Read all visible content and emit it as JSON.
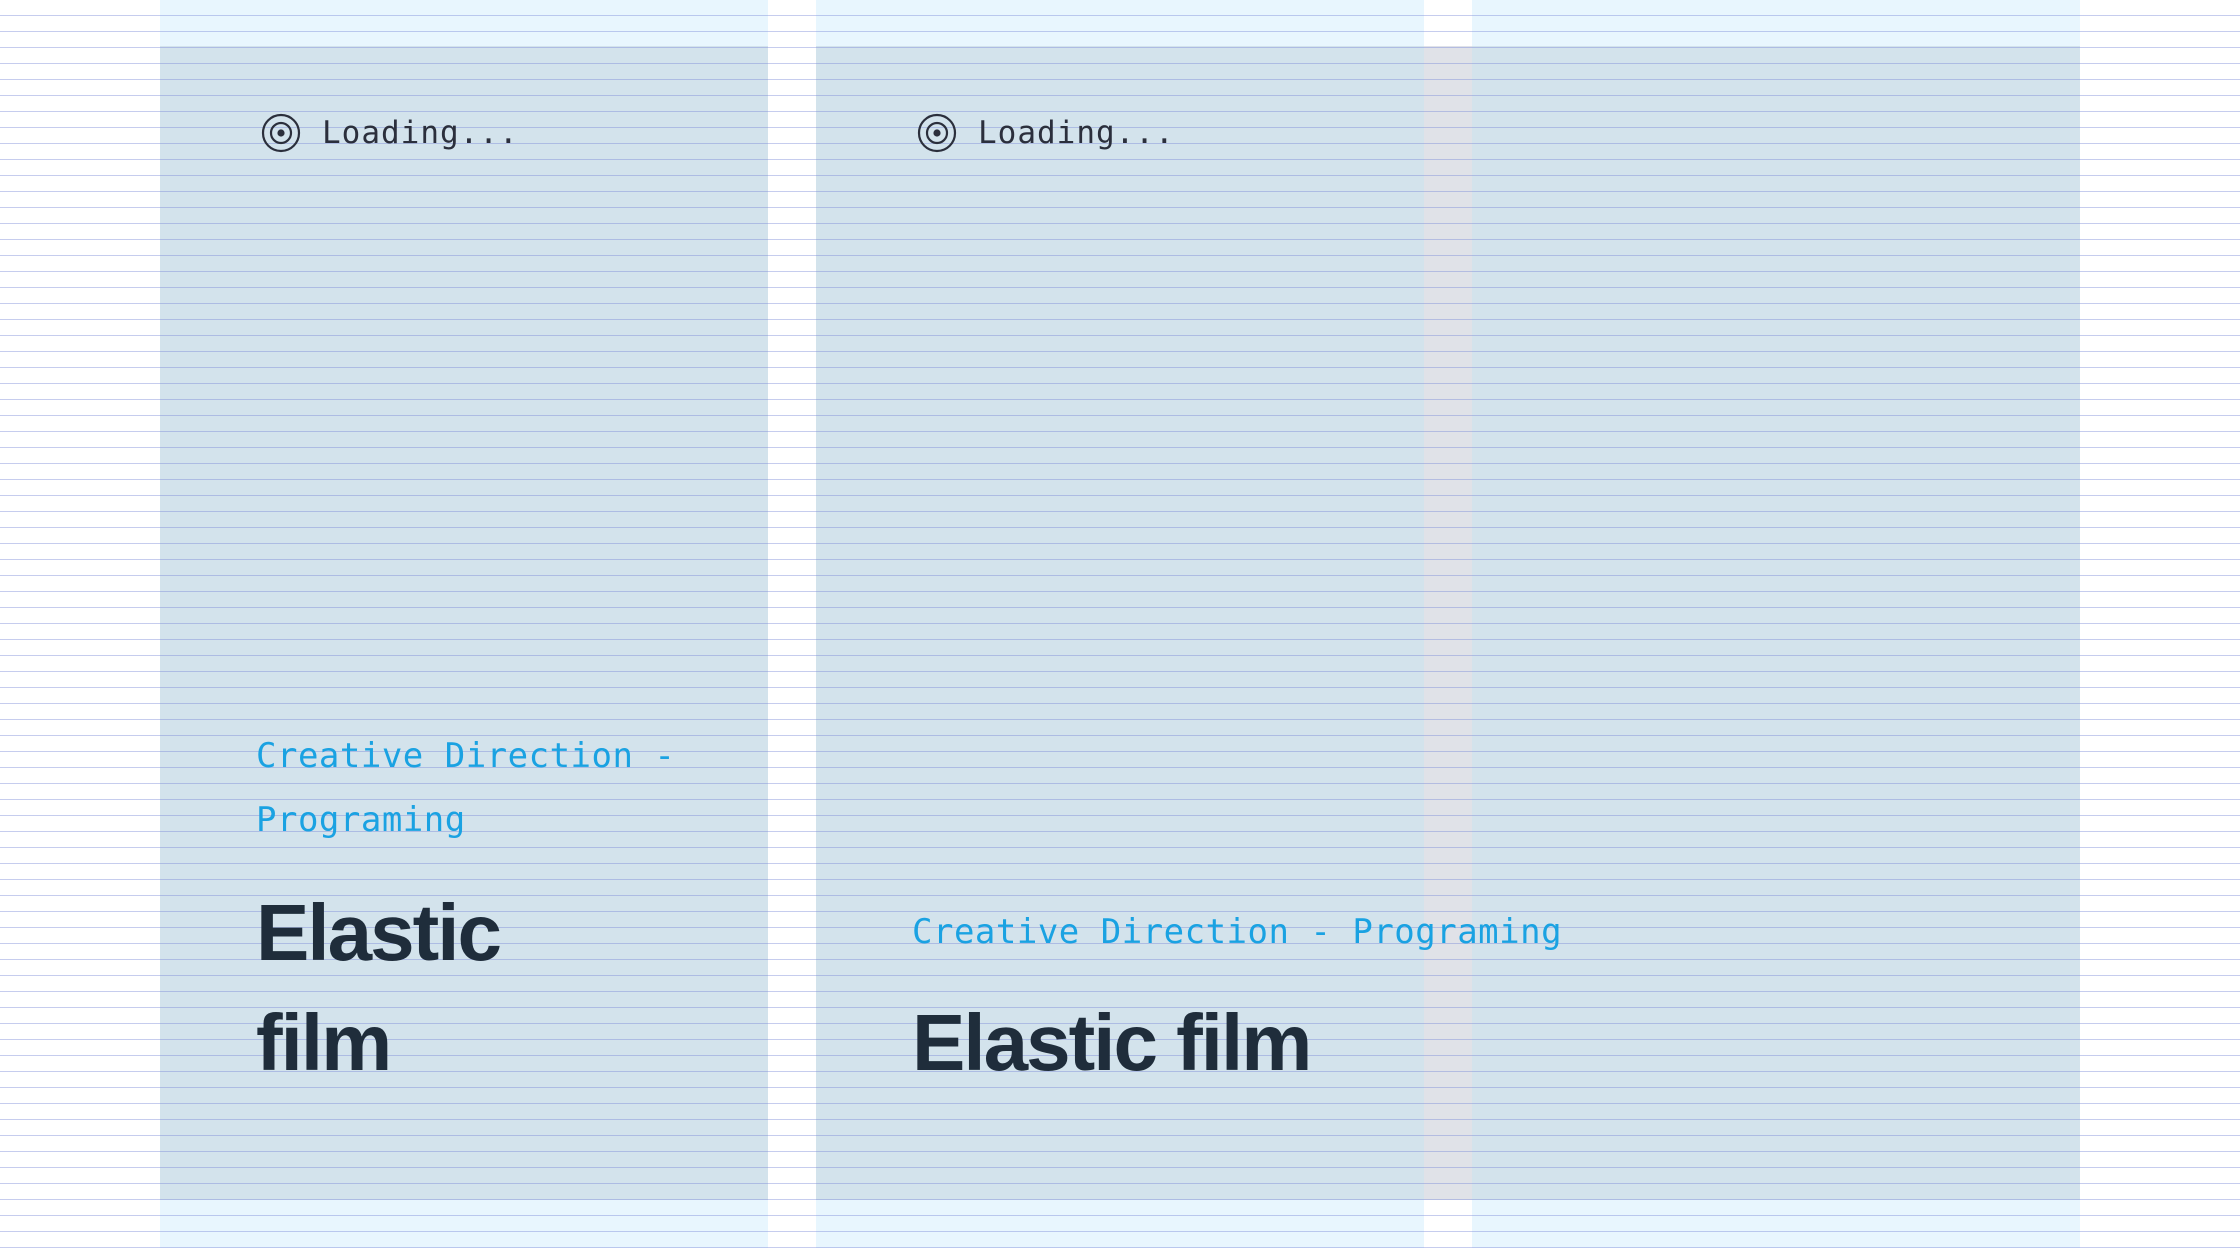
{
  "cards": [
    {
      "loader": {
        "text": "Loading...",
        "icon": "loading-target-icon"
      },
      "category": "Creative Direction - Programing",
      "title": "Elastic film"
    },
    {
      "loader": {
        "text": "Loading...",
        "icon": "loading-target-icon"
      },
      "category": "Creative Direction - Programing",
      "title": "Elastic film"
    }
  ],
  "colors": {
    "category_text": "#1aa2e2",
    "title_text": "#1f2d3b",
    "card_background": "#d3e3ec",
    "column_band": "#e8f6fe",
    "baseline_lines": "#7887d7"
  }
}
